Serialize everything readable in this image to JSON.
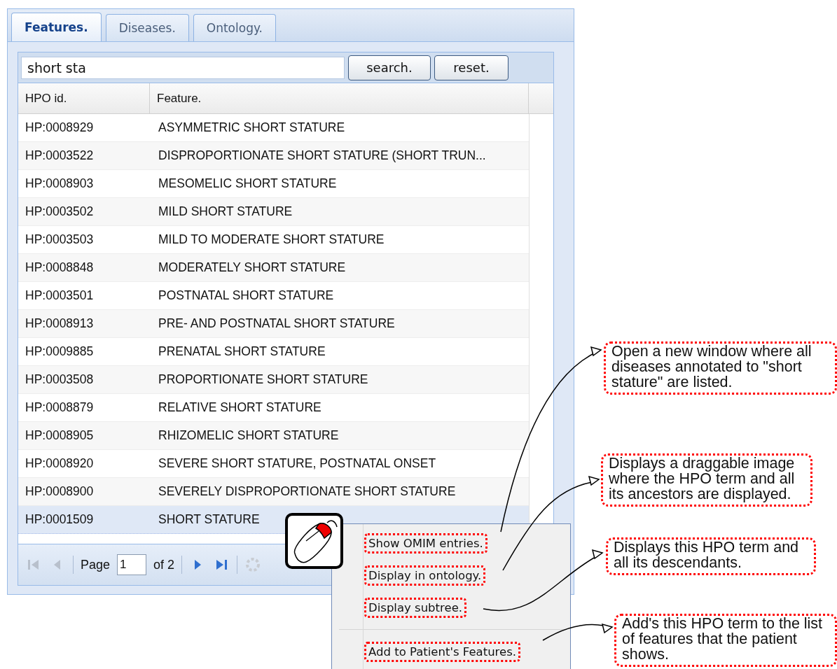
{
  "tabs": [
    {
      "label": "Features.",
      "selected": true
    },
    {
      "label": "Diseases.",
      "selected": false
    },
    {
      "label": "Ontology.",
      "selected": false
    }
  ],
  "search": {
    "value": "short sta"
  },
  "buttons": [
    "search.",
    "reset."
  ],
  "table": {
    "columns": [
      "HPO id.",
      "Feature."
    ],
    "rows": [
      {
        "id": "HP:0008929",
        "feature": "ASYMMETRIC SHORT STATURE",
        "selected": false
      },
      {
        "id": "HP:0003522",
        "feature": "DISPROPORTIONATE SHORT STATURE (SHORT TRUN...",
        "selected": false
      },
      {
        "id": "HP:0008903",
        "feature": "MESOMELIC SHORT STATURE",
        "selected": false
      },
      {
        "id": "HP:0003502",
        "feature": "MILD SHORT STATURE",
        "selected": false
      },
      {
        "id": "HP:0003503",
        "feature": "MILD TO MODERATE SHORT STATURE",
        "selected": false
      },
      {
        "id": "HP:0008848",
        "feature": "MODERATELY SHORT STATURE",
        "selected": false
      },
      {
        "id": "HP:0003501",
        "feature": "POSTNATAL SHORT STATURE",
        "selected": false
      },
      {
        "id": "HP:0008913",
        "feature": "PRE- AND POSTNATAL SHORT STATURE",
        "selected": false
      },
      {
        "id": "HP:0009885",
        "feature": "PRENATAL SHORT STATURE",
        "selected": false
      },
      {
        "id": "HP:0003508",
        "feature": "PROPORTIONATE SHORT STATURE",
        "selected": false
      },
      {
        "id": "HP:0008879",
        "feature": "RELATIVE SHORT STATURE",
        "selected": false
      },
      {
        "id": "HP:0008905",
        "feature": "RHIZOMELIC SHORT STATURE",
        "selected": false
      },
      {
        "id": "HP:0008920",
        "feature": "SEVERE SHORT STATURE, POSTNATAL ONSET",
        "selected": false
      },
      {
        "id": "HP:0008900",
        "feature": "SEVERELY DISPROPORTIONATE SHORT STATURE",
        "selected": false
      },
      {
        "id": "HP:0001509",
        "feature": "SHORT STATURE",
        "selected": true
      }
    ]
  },
  "paging": {
    "nav": [
      {
        "kind": "first",
        "disabled": true
      },
      {
        "kind": "prev",
        "disabled": true
      },
      {
        "kind": "next",
        "disabled": false
      },
      {
        "kind": "last",
        "disabled": false
      }
    ],
    "page_label": "Page",
    "page_value": "1",
    "of_label": "of 2"
  },
  "context_menu": {
    "items": [
      {
        "label": "Show OMIM entries.",
        "separator_before": false
      },
      {
        "label": "Display in ontology.",
        "separator_before": false
      },
      {
        "label": "Display subtree.",
        "separator_before": false
      },
      {
        "label": "Add to Patient's Features.",
        "separator_before": true
      }
    ]
  },
  "callouts": [
    {
      "text": "Open a new window where all diseases annotated to \"short stature\" are listed."
    },
    {
      "text": "Displays a draggable image where the HPO term and all its ancestors are displayed."
    },
    {
      "text": "Displays this HPO term and all its descendants."
    },
    {
      "text": "Add's this HPO term to the list of features that the patient shows."
    }
  ]
}
